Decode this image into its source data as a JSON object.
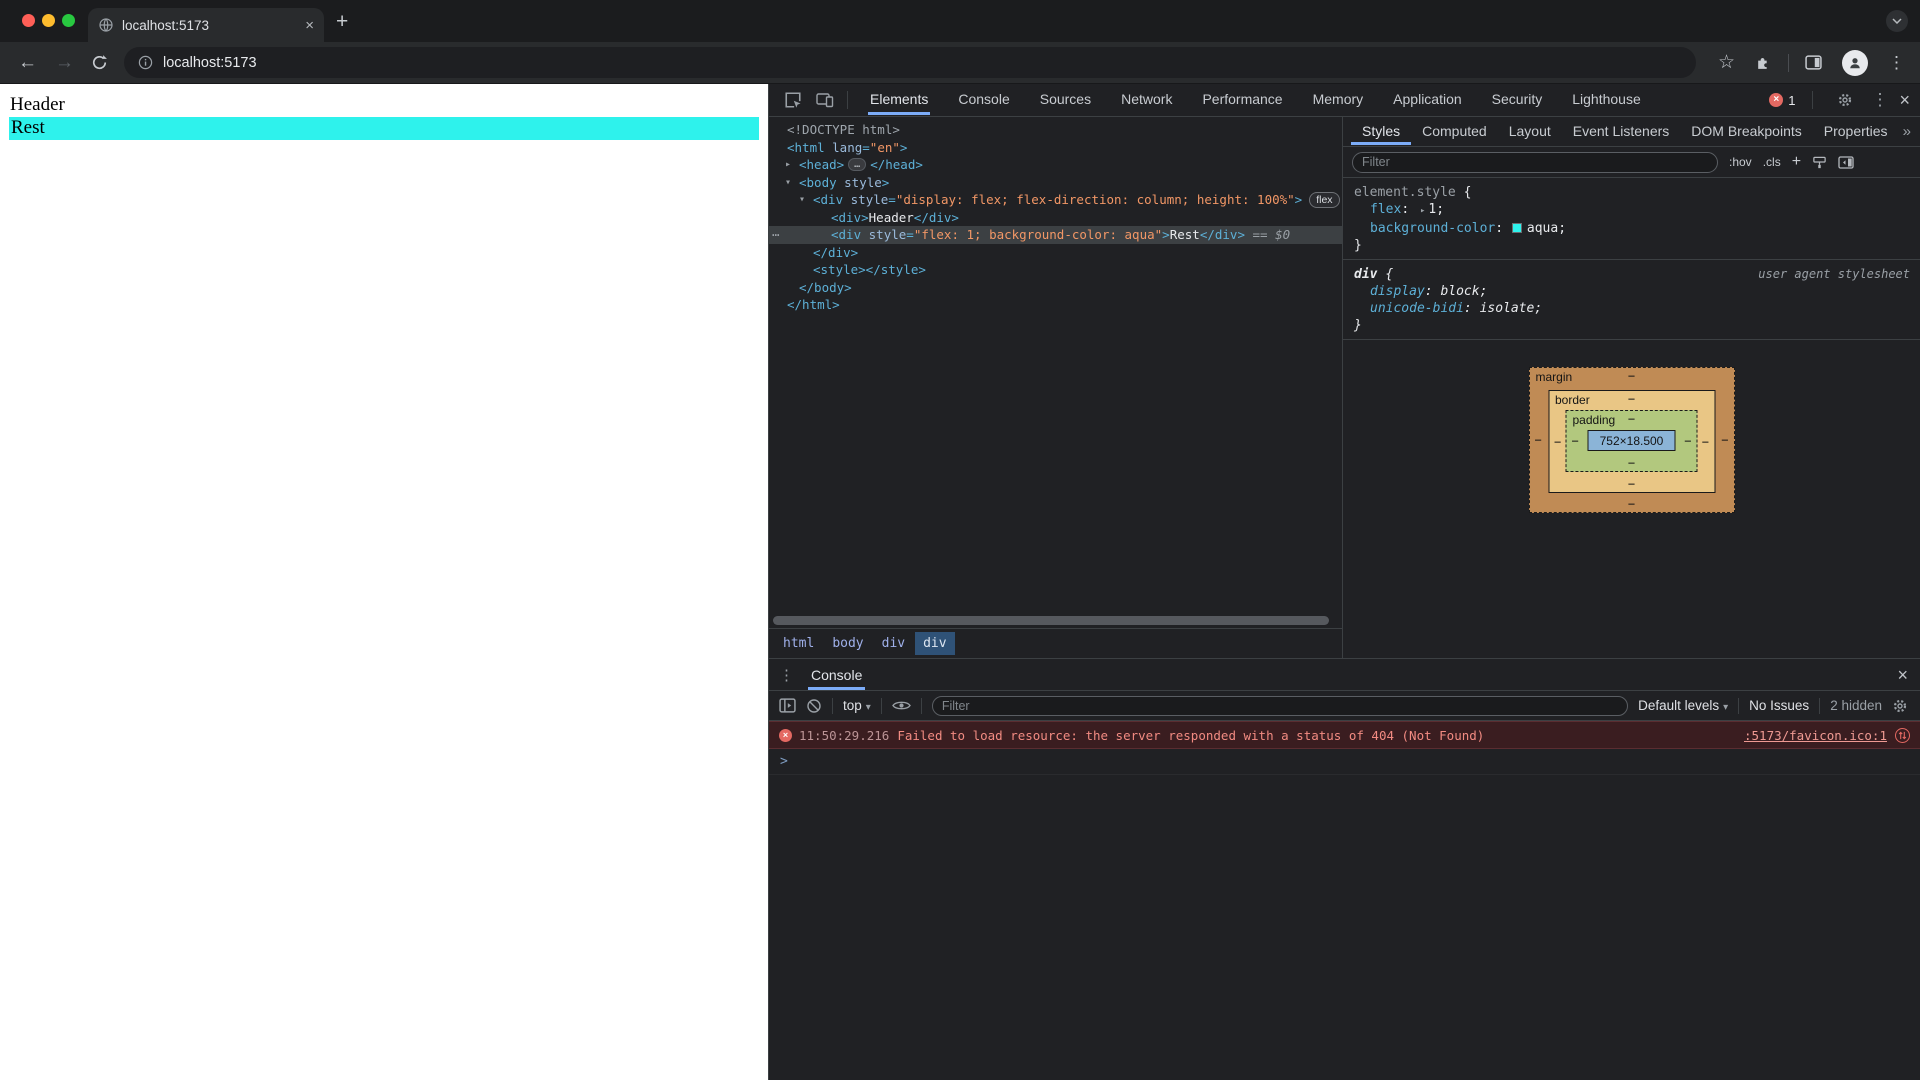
{
  "icons": {
    "close": "×",
    "new_tab": "+",
    "back": "←",
    "forward": "→",
    "more_v": "⋮",
    "more_h": "⋯",
    "overflow": "»",
    "dropdown": "▾",
    "star": "☆",
    "expand_down": "▾",
    "expand_right": "▸",
    "ellipsis": "…",
    "dash": "−",
    "prompt": ">",
    "plus": "+"
  },
  "colors": {
    "accent_blue": "#7cacf8",
    "error_red": "#e46962",
    "aqua": "#00ffff"
  },
  "chrome": {
    "tab_title": "localhost:5173",
    "url": "localhost:5173"
  },
  "page": {
    "header": "Header",
    "rest": "Rest"
  },
  "devtools": {
    "main_tabs": [
      {
        "label": "Elements",
        "selected": true
      },
      {
        "label": "Console"
      },
      {
        "label": "Sources"
      },
      {
        "label": "Network"
      },
      {
        "label": "Performance"
      },
      {
        "label": "Memory"
      },
      {
        "label": "Application"
      },
      {
        "label": "Security"
      },
      {
        "label": "Lighthouse"
      }
    ],
    "error_badge_count": "1",
    "dom_tree": {
      "lines": [
        {
          "lvl": 0,
          "segs": [
            {
              "t": "<!DOCTYPE html>",
              "k": "m"
            }
          ]
        },
        {
          "lvl": 0,
          "segs": [
            {
              "t": "<html ",
              "k": "t"
            },
            {
              "t": "lang",
              "k": "a"
            },
            {
              "t": "=",
              "k": "t"
            },
            {
              "t": "\"en\"",
              "k": "v"
            },
            {
              "t": ">",
              "k": "t"
            }
          ]
        },
        {
          "lvl": 1,
          "arrow": "right",
          "segs": [
            {
              "t": "<head>",
              "k": "t"
            },
            {
              "t": "…",
              "k": "el"
            },
            {
              "t": "</head>",
              "k": "t"
            }
          ]
        },
        {
          "lvl": 1,
          "arrow": "down",
          "segs": [
            {
              "t": "<body ",
              "k": "t"
            },
            {
              "t": "style",
              "k": "a"
            },
            {
              "t": ">",
              "k": "t"
            }
          ]
        },
        {
          "lvl": 2,
          "arrow": "down",
          "segs": [
            {
              "t": "<div ",
              "k": "t"
            },
            {
              "t": "style",
              "k": "a"
            },
            {
              "t": "=",
              "k": "t"
            },
            {
              "t": "\"display: flex; flex-direction: column; height: 100%\"",
              "k": "v"
            },
            {
              "t": ">",
              "k": "t"
            },
            {
              "t": "flex",
              "k": "fb"
            }
          ]
        },
        {
          "lvl": 3,
          "segs": [
            {
              "t": "<div>",
              "k": "t"
            },
            {
              "t": "Header",
              "k": "x"
            },
            {
              "t": "</div>",
              "k": "t"
            }
          ]
        },
        {
          "lvl": 3,
          "selected": true,
          "segs": [
            {
              "t": "<div ",
              "k": "t"
            },
            {
              "t": "style",
              "k": "a"
            },
            {
              "t": "=",
              "k": "t"
            },
            {
              "t": "\"flex: 1; background-color: aqua\"",
              "k": "v"
            },
            {
              "t": ">",
              "k": "t"
            },
            {
              "t": "Rest",
              "k": "x"
            },
            {
              "t": "</div>",
              "k": "t"
            },
            {
              "t": " == $0",
              "k": "d"
            }
          ]
        },
        {
          "lvl": 2,
          "segs": [
            {
              "t": "</div>",
              "k": "t"
            }
          ]
        },
        {
          "lvl": 2,
          "segs": [
            {
              "t": "<style></style>",
              "k": "t"
            }
          ]
        },
        {
          "lvl": 1,
          "segs": [
            {
              "t": "</body>",
              "k": "t"
            }
          ]
        },
        {
          "lvl": 0,
          "segs": [
            {
              "t": "</html>",
              "k": "t"
            }
          ]
        }
      ]
    },
    "breadcrumbs": [
      {
        "label": "html"
      },
      {
        "label": "body"
      },
      {
        "label": "div"
      },
      {
        "label": "div",
        "selected": true
      }
    ],
    "styles_panel": {
      "tabs": [
        {
          "label": "Styles",
          "selected": true
        },
        {
          "label": "Computed"
        },
        {
          "label": "Layout"
        },
        {
          "label": "Event Listeners"
        },
        {
          "label": "DOM Breakpoints"
        },
        {
          "label": "Properties"
        }
      ],
      "filter_placeholder": "Filter",
      "toggles": {
        "hov": ":hov",
        "cls": ".cls"
      },
      "element_style": {
        "selector": "element.style",
        "open": "{",
        "close": "}",
        "props": [
          {
            "name": "flex",
            "colon": ": ",
            "value": "1;"
          },
          {
            "name": "background-color",
            "colon": ": ",
            "value": "aqua;"
          }
        ]
      },
      "ua_rule": {
        "selector": "div",
        "open": "{",
        "close": "}",
        "origin": "user agent stylesheet",
        "props": [
          {
            "name": "display",
            "colon": ": ",
            "value": "block;"
          },
          {
            "name": "unicode-bidi",
            "colon": ": ",
            "value": "isolate;"
          }
        ]
      },
      "box_model": {
        "margin_label": "margin",
        "border_label": "border",
        "padding_label": "padding",
        "content": "752×18.500"
      }
    },
    "console": {
      "tab_label": "Console",
      "context": "top",
      "filter_placeholder": "Filter",
      "levels": "Default levels",
      "no_issues": "No Issues",
      "hidden": "2 hidden",
      "error": {
        "timestamp": "11:50:29.216",
        "message": "Failed to load resource: the server responded with a status of 404 (Not Found)",
        "source_link": ":5173/favicon.ico:1"
      }
    }
  }
}
